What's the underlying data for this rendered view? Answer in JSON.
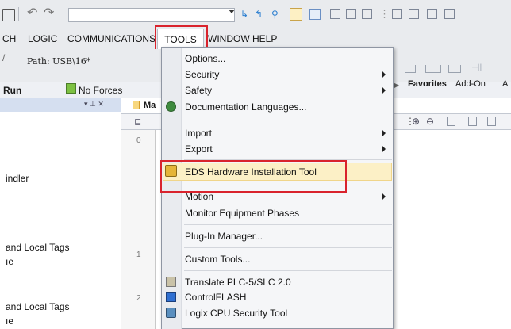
{
  "toolbar": {
    "path_input_value": "",
    "icons": [
      "home-icon",
      "undo-icon",
      "redo-icon",
      "path-dropdown-icon",
      "toggle-icon-1",
      "toggle-icon-2",
      "filter-icon",
      "view-icon-1",
      "view-icon-2",
      "copy-icon",
      "paste-icon",
      "toolbox-icon",
      "bookmark-icon",
      "cross-reference-icon",
      "tag-icon-1",
      "tag-icon-2"
    ]
  },
  "menubar": {
    "items": [
      "CH",
      "LOGIC",
      "COMMUNICATIONS",
      "TOOLS",
      "WINDOW",
      "HELP"
    ]
  },
  "pathrow": {
    "path_label": "Path: USB\\16*",
    "run_label": "Run",
    "forces_label": "No Forces",
    "tabs": [
      "Favorites",
      "Add-On",
      "A"
    ]
  },
  "left_pane": {
    "pin_symbol": "▾ ⊥ ✕",
    "items": [
      "indler",
      "and Local Tags",
      "ıe",
      "and Local Tags",
      "ıe"
    ]
  },
  "main": {
    "tab_label": "Ma",
    "row_numbers": [
      "0",
      "1",
      "2"
    ]
  },
  "tools_menu": {
    "items": [
      {
        "label": "Options...",
        "submenu": false
      },
      {
        "label": "Security",
        "submenu": true
      },
      {
        "label": "Safety",
        "submenu": true
      },
      {
        "label": "Documentation Languages...",
        "submenu": false
      },
      {
        "label": "Import",
        "submenu": true
      },
      {
        "label": "Export",
        "submenu": true
      },
      {
        "label": "EDS Hardware Installation Tool",
        "submenu": false,
        "highlighted": true
      },
      {
        "label": "Motion",
        "submenu": true
      },
      {
        "label": "Monitor Equipment Phases",
        "submenu": false
      },
      {
        "label": "Plug-In Manager...",
        "submenu": false
      },
      {
        "label": "Custom Tools...",
        "submenu": false
      },
      {
        "label": "Translate PLC-5/SLC 2.0",
        "submenu": false
      },
      {
        "label": "ControlFLASH",
        "submenu": false
      },
      {
        "label": "Logix CPU Security Tool",
        "submenu": false
      }
    ]
  },
  "colors": {
    "highlight": "#fcf0c6",
    "highlight_border": "#f0d58a",
    "callout_red": "#d9232d",
    "selected_menu_bg": "#ffffff"
  }
}
